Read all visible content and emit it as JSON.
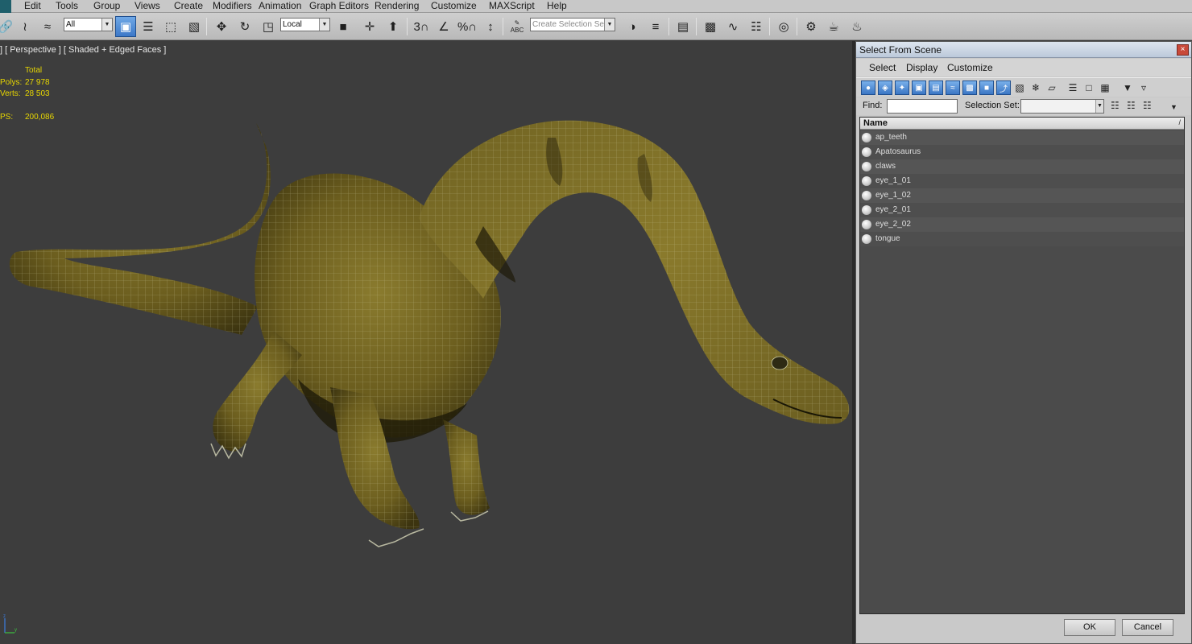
{
  "menubar": {
    "items": [
      "Edit",
      "Tools",
      "Group",
      "Views",
      "Create",
      "Modifiers",
      "Animation",
      "Graph Editors",
      "Rendering",
      "Customize",
      "MAXScript",
      "Help"
    ]
  },
  "toolbar": {
    "filter_value": "All",
    "coord_value": "Local",
    "selection_set_placeholder": "Create Selection Se",
    "snap_label": "3",
    "percent_label": "%",
    "abc_label": "ABC"
  },
  "viewport": {
    "label": "] [ Perspective ] [ Shaded + Edged Faces ]",
    "stats": {
      "header": "Total",
      "polys_label": "Polys:",
      "polys_value": "27 978",
      "verts_label": "Verts:",
      "verts_value": "28 503",
      "fps_label": "PS:",
      "fps_value": "200,086"
    },
    "axis": {
      "x": "x",
      "y": "y",
      "z": "z"
    }
  },
  "dialog": {
    "title": "Select From Scene",
    "close_glyph": "×",
    "menu": [
      "Select",
      "Display",
      "Customize"
    ],
    "find_label": "Find:",
    "find_value": "",
    "selection_set_label": "Selection Set:",
    "selection_set_value": "",
    "column_header": "Name",
    "sort_glyph": "/",
    "objects": [
      "ap_teeth",
      "Apatosaurus",
      "claws",
      "eye_1_01",
      "eye_1_02",
      "eye_2_01",
      "eye_2_02",
      "tongue"
    ],
    "ok_label": "OK",
    "cancel_label": "Cancel"
  }
}
